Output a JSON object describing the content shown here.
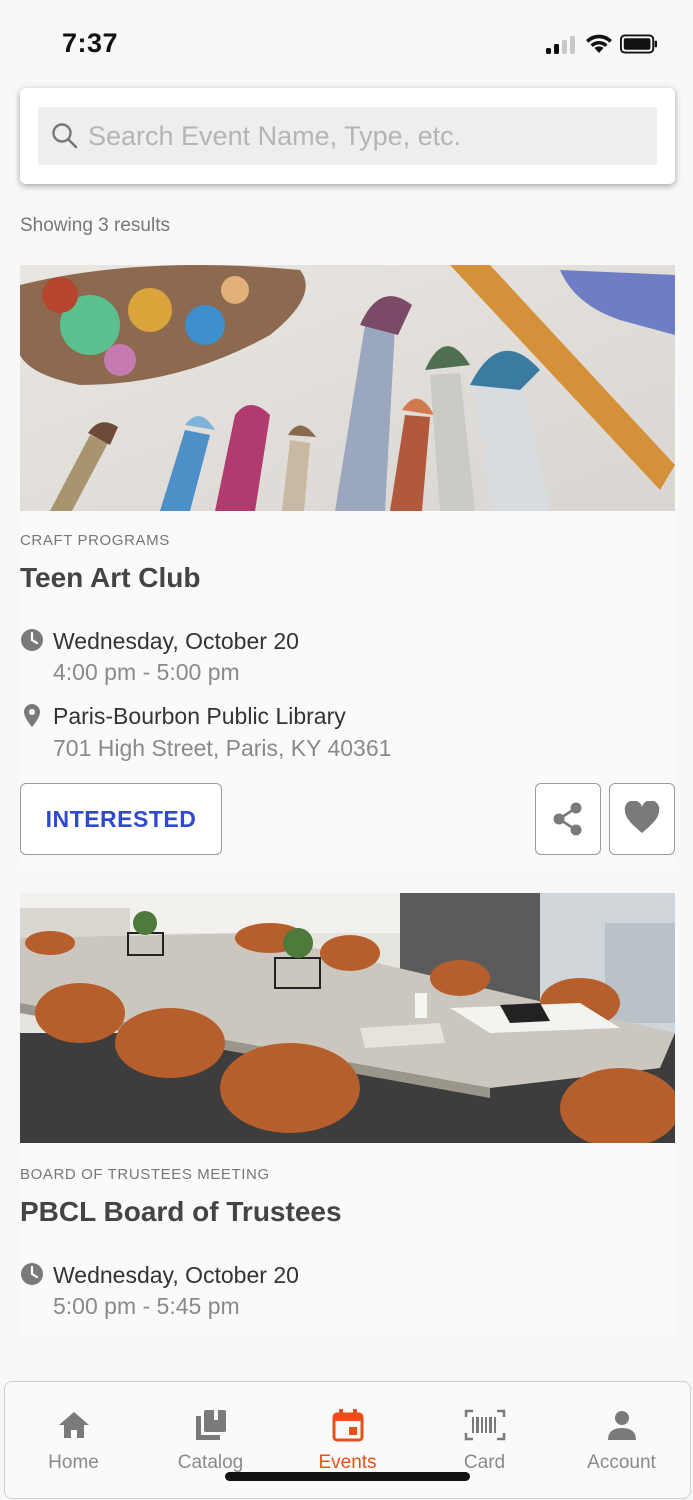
{
  "status_bar": {
    "time": "7:37"
  },
  "search": {
    "placeholder": "Search Event Name, Type, etc.",
    "value": ""
  },
  "results": {
    "count_text": "Showing 3 results"
  },
  "events": [
    {
      "type": "CRAFT PROGRAMS",
      "title": "Teen Art Club",
      "date": "Wednesday, October 20",
      "time": "4:00 pm - 5:00 pm",
      "location_name": "Paris-Bourbon Public Library",
      "location_address": "701 High Street, Paris, KY 40361",
      "interested_label": "INTERESTED"
    },
    {
      "type": "BOARD OF TRUSTEES MEETING",
      "title": "PBCL Board of Trustees",
      "date": "Wednesday, October 20",
      "time": "5:00 pm - 5:45 pm"
    }
  ],
  "nav": {
    "items": [
      {
        "label": "Home",
        "icon": "home-icon"
      },
      {
        "label": "Catalog",
        "icon": "catalog-icon"
      },
      {
        "label": "Events",
        "icon": "events-calendar-icon",
        "active": true
      },
      {
        "label": "Card",
        "icon": "barcode-card-icon"
      },
      {
        "label": "Account",
        "icon": "account-person-icon"
      }
    ]
  },
  "colors": {
    "accent": "#e8501a",
    "link_blue": "#2f49d1",
    "icon_gray": "#7a7a7a"
  }
}
